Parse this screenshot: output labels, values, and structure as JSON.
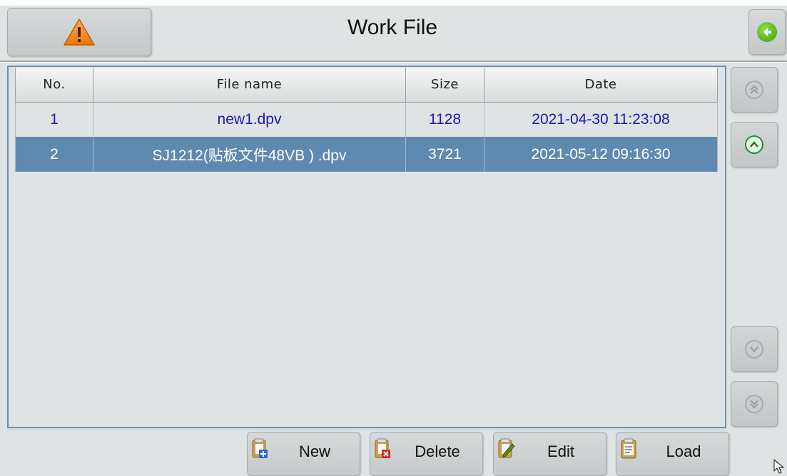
{
  "header": {
    "title": "Work File",
    "warning_icon": "warning-triangle-icon",
    "back_icon": "back-arrow-icon"
  },
  "table": {
    "columns": [
      "No.",
      "File name",
      "Size",
      "Date"
    ],
    "rows": [
      {
        "no": "1",
        "file_name": "new1.dpv",
        "size": "1128",
        "date": "2021-04-30 11:23:08",
        "selected": false
      },
      {
        "no": "2",
        "file_name": "SJ1212(贴板文件48VB ) .dpv",
        "size": "3721",
        "date": "2021-05-12 09:16:30",
        "selected": true
      }
    ]
  },
  "scroll": {
    "page_up_icon": "double-chevron-up-icon",
    "line_up_icon": "chevron-up-icon",
    "line_down_icon": "chevron-down-icon",
    "page_down_icon": "double-chevron-down-icon"
  },
  "toolbar": {
    "new_label": "New",
    "delete_label": "Delete",
    "edit_label": "Edit",
    "load_label": "Load"
  },
  "colors": {
    "selected_row": "#5f89b0",
    "row_text": "#1a1ab4",
    "background": "#dfe3e3",
    "panel_border": "#6d8eb0"
  }
}
